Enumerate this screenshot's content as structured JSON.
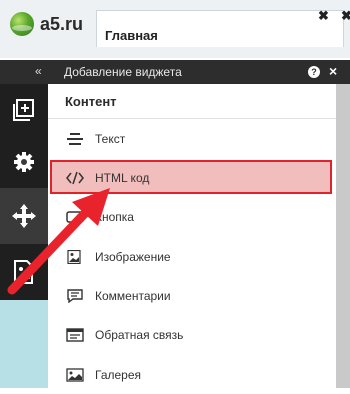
{
  "browser": {
    "logo_text": "a5.ru",
    "tab_title": "Главная",
    "close_symbol": "✖"
  },
  "panel": {
    "collapse_symbol": "«",
    "title": "Добавление виджета",
    "help_symbol": "?",
    "close_symbol": "×"
  },
  "left_toolbar": {
    "items": [
      "add-icon",
      "gear-icon",
      "move-icon",
      "image-settings-icon"
    ]
  },
  "content": {
    "section_title": "Контент",
    "items": [
      {
        "label": "Текст",
        "icon": "text-icon"
      },
      {
        "label": "HTML код",
        "icon": "code-icon"
      },
      {
        "label": "Кнопка",
        "icon": "button-icon"
      },
      {
        "label": "Изображение",
        "icon": "image-icon"
      },
      {
        "label": "Комментарии",
        "icon": "comment-icon"
      },
      {
        "label": "Обратная связь",
        "icon": "feedback-icon"
      },
      {
        "label": "Галерея",
        "icon": "gallery-icon"
      }
    ]
  },
  "colors": {
    "selection_bg": "#f2bdbd",
    "selection_border": "#e0222a",
    "arrow": "#e8232b",
    "toolbar_bg": "#1f1f1f"
  }
}
